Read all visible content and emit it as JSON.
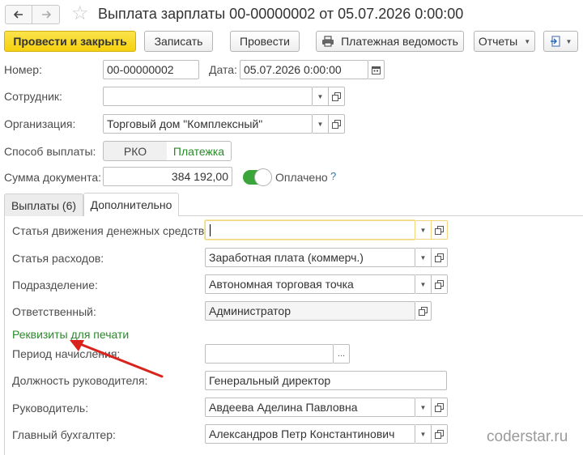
{
  "header": {
    "title": "Выплата зарплаты 00-00000002 от 05.07.2026 0:00:00",
    "back_icon": "arrow-left-icon",
    "forward_icon": "arrow-right-icon",
    "favorite_icon": "star-icon"
  },
  "toolbar": {
    "post_close_label": "Провести и закрыть",
    "save_label": "Записать",
    "post_label": "Провести",
    "payroll_label": "Платежная ведомость",
    "reports_label": "Отчеты",
    "print_icon": "printer-icon",
    "more_icon": "document-arrow-icon"
  },
  "form": {
    "number_label": "Номер:",
    "number_value": "00-00000002",
    "date_label": "Дата:",
    "date_value": "05.07.2026  0:00:00",
    "employee_label": "Сотрудник:",
    "employee_value": "",
    "organization_label": "Организация:",
    "organization_value": "Торговый дом \"Комплексный\"",
    "payment_method_label": "Способ выплаты:",
    "payment_method_options": [
      "РКО",
      "Платежка"
    ],
    "payment_method_selected": "Платежка",
    "amount_label": "Сумма документа:",
    "amount_value": "384 192,00",
    "paid_label": "Оплачено",
    "paid_on": true,
    "help_label": "?"
  },
  "tabs": [
    {
      "label": "Выплаты (6)",
      "active": false
    },
    {
      "label": "Дополнительно",
      "active": true
    }
  ],
  "additional": {
    "cash_flow_label": "Статья движения денежных средств:",
    "cash_flow_value": "",
    "expense_label": "Статья расходов:",
    "expense_value": "Заработная плата (коммерч.)",
    "division_label": "Подразделение:",
    "division_value": "Автономная торговая точка",
    "responsible_label": "Ответственный:",
    "responsible_value": "Администратор",
    "print_details_link": "Реквизиты для печати",
    "accrual_period_label": "Период начисления:",
    "accrual_period_value": "",
    "accrual_period_btn": "...",
    "head_position_label": "Должность руководителя:",
    "head_position_value": "Генеральный директор",
    "head_label": "Руководитель:",
    "head_value": "Авдеева Аделина Павловна",
    "chief_accountant_label": "Главный бухгалтер:",
    "chief_accountant_value": "Александров Петр Константинович"
  },
  "watermark": "coderstar.ru",
  "colors": {
    "primary_button": "#f5d10f",
    "link_green": "#2a8a2a",
    "toggle_green": "#3aa53a",
    "annotation_arrow": "#d9231d"
  }
}
